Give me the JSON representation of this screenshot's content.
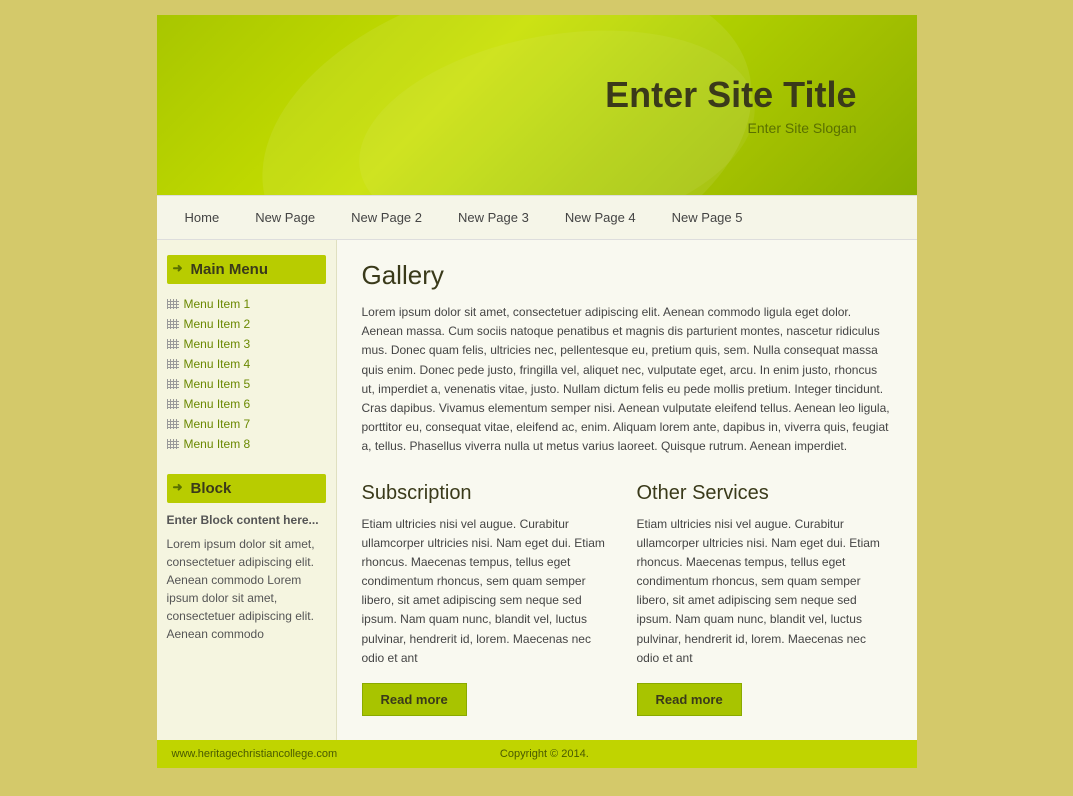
{
  "header": {
    "title": "Enter Site Title",
    "slogan": "Enter Site Slogan"
  },
  "nav": {
    "items": [
      {
        "label": "Home"
      },
      {
        "label": "New Page"
      },
      {
        "label": "New Page 2"
      },
      {
        "label": "New Page 3"
      },
      {
        "label": "New Page 4"
      },
      {
        "label": "New Page 5"
      }
    ]
  },
  "sidebar": {
    "main_menu_title": "Main Menu",
    "menu_items": [
      {
        "label": "Menu Item 1"
      },
      {
        "label": "Menu Item 2"
      },
      {
        "label": "Menu Item 3"
      },
      {
        "label": "Menu Item 4"
      },
      {
        "label": "Menu Item 5"
      },
      {
        "label": "Menu Item 6"
      },
      {
        "label": "Menu Item 7"
      },
      {
        "label": "Menu Item 8"
      }
    ],
    "block_title": "Block",
    "block_text": "Enter Block content here...",
    "block_lorem": "Lorem ipsum dolor sit amet, consectetuer adipiscing elit. Aenean commodo Lorem ipsum dolor sit amet, consectetuer adipiscing elit. Aenean commodo"
  },
  "content": {
    "gallery": {
      "title": "Gallery",
      "text": "Lorem ipsum dolor sit amet, consectetuer adipiscing elit. Aenean commodo ligula eget dolor. Aenean massa. Cum sociis natoque penatibus et magnis dis parturient montes, nascetur ridiculus mus. Donec quam felis, ultricies nec, pellentesque eu, pretium quis, sem. Nulla consequat massa quis enim. Donec pede justo, fringilla vel, aliquet nec, vulputate eget, arcu. In enim justo, rhoncus ut, imperdiet a, venenatis vitae, justo. Nullam dictum felis eu pede mollis pretium. Integer tincidunt. Cras dapibus. Vivamus elementum semper nisi. Aenean vulputate eleifend tellus. Aenean leo ligula, porttitor eu, consequat vitae, eleifend ac, enim. Aliquam lorem ante, dapibus in, viverra quis, feugiat a, tellus. Phasellus viverra nulla ut metus varius laoreet. Quisque rutrum. Aenean imperdiet."
    },
    "subscription": {
      "title": "Subscription",
      "text": "Etiam ultricies nisi vel augue. Curabitur ullamcorper ultricies nisi. Nam eget dui. Etiam rhoncus. Maecenas tempus, tellus eget condimentum rhoncus, sem quam semper libero, sit amet adipiscing sem neque sed ipsum. Nam quam nunc, blandit vel, luctus pulvinar, hendrerit id, lorem. Maecenas nec odio et ant",
      "button": "Read more"
    },
    "other_services": {
      "title": "Other Services",
      "text": "Etiam ultricies nisi vel augue. Curabitur ullamcorper ultricies nisi. Nam eget dui. Etiam rhoncus. Maecenas tempus, tellus eget condimentum rhoncus, sem quam semper libero, sit amet adipiscing sem neque sed ipsum. Nam quam nunc, blandit vel, luctus pulvinar, hendrerit id, lorem. Maecenas nec odio et ant",
      "button": "Read more"
    }
  },
  "footer": {
    "left": "www.heritagechristiancollege.com",
    "copyright": "Copyright © 2014."
  }
}
